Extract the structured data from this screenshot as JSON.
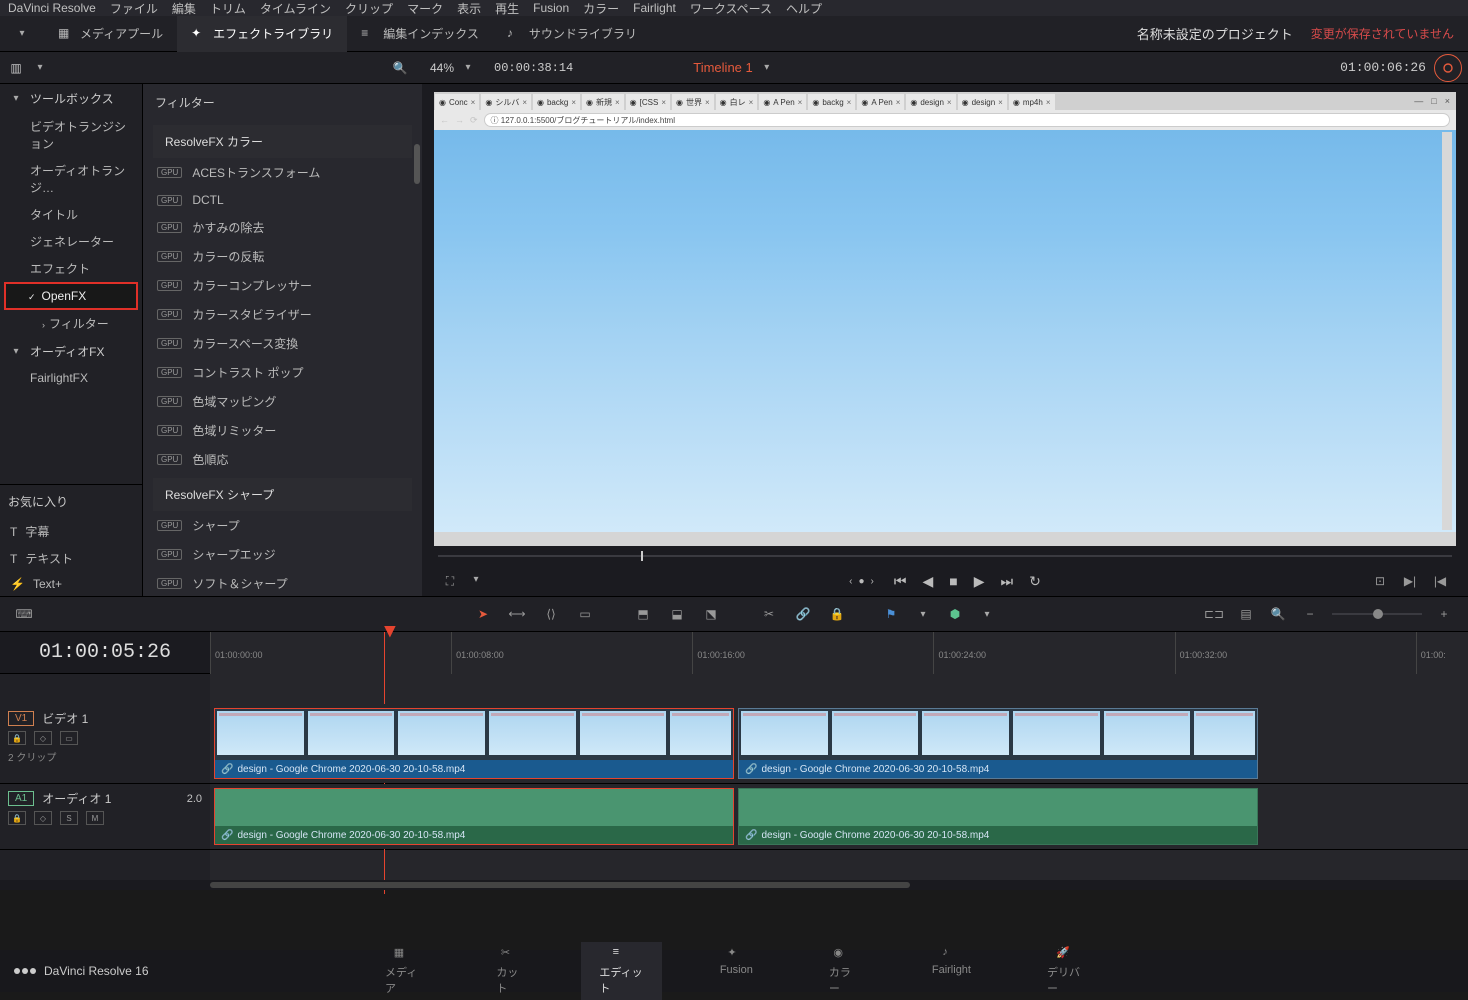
{
  "menubar": [
    "DaVinci Resolve",
    "ファイル",
    "編集",
    "トリム",
    "タイムライン",
    "クリップ",
    "マーク",
    "表示",
    "再生",
    "Fusion",
    "カラー",
    "Fairlight",
    "ワークスペース",
    "ヘルプ"
  ],
  "toolbar": {
    "media_pool": "メディアプール",
    "fx_library": "エフェクトライブラリ",
    "edit_index": "編集インデックス",
    "sound_library": "サウンドライブラリ"
  },
  "project": {
    "name": "名称未設定のプロジェクト",
    "unsaved": "変更が保存されていません"
  },
  "viewer_bar": {
    "zoom": "44%",
    "tc_small": "00:00:38:14",
    "timeline_name": "Timeline 1",
    "tc_right": "01:00:06:26"
  },
  "tree": {
    "toolbox": "ツールボックス",
    "items": [
      "ビデオトランジション",
      "オーディオトランジ…",
      "タイトル",
      "ジェネレーター",
      "エフェクト"
    ],
    "openfx": "OpenFX",
    "filter": "フィルター",
    "audiofx": "オーディオFX",
    "fairlight": "FairlightFX"
  },
  "favorites": {
    "title": "お気に入り",
    "items": [
      "字幕",
      "テキスト",
      "Text+"
    ]
  },
  "fx": {
    "header": "フィルター",
    "group1": "ResolveFX カラー",
    "items1": [
      "ACESトランスフォーム",
      "DCTL",
      "かすみの除去",
      "カラーの反転",
      "カラーコンプレッサー",
      "カラースタビライザー",
      "カラースペース変換",
      "コントラスト ポップ",
      "色域マッピング",
      "色域リミッター",
      "色順応"
    ],
    "group2": "ResolveFX シャープ",
    "items2": [
      "シャープ",
      "シャープエッジ",
      "ソフト＆シャープ"
    ]
  },
  "browser": {
    "tabs": [
      "Conc",
      "シルバ",
      "backg",
      "新規",
      "[CSS",
      "世界",
      "白レ",
      "A Pen",
      "backg",
      "A Pen",
      "design",
      "design",
      "mp4h"
    ],
    "url": "127.0.0.1:5500/ブログチュートリアル/index.html"
  },
  "tl": {
    "big_tc": "01:00:05:26",
    "ticks": [
      "01:00:00:00",
      "01:00:08:00",
      "01:00:16:00",
      "01:00:24:00",
      "01:00:32:00",
      "01:00:"
    ],
    "v1": {
      "badge": "V1",
      "name": "ビデオ 1",
      "info": "2 クリップ"
    },
    "a1": {
      "badge": "A1",
      "name": "オーディオ 1",
      "ch": "2.0"
    },
    "clip_name": "design - Google Chrome 2020-06-30 20-10-58.mp4"
  },
  "pages": {
    "app": "DaVinci Resolve 16",
    "items": [
      "メディア",
      "カット",
      "エディット",
      "Fusion",
      "カラー",
      "Fairlight",
      "デリバー"
    ]
  }
}
